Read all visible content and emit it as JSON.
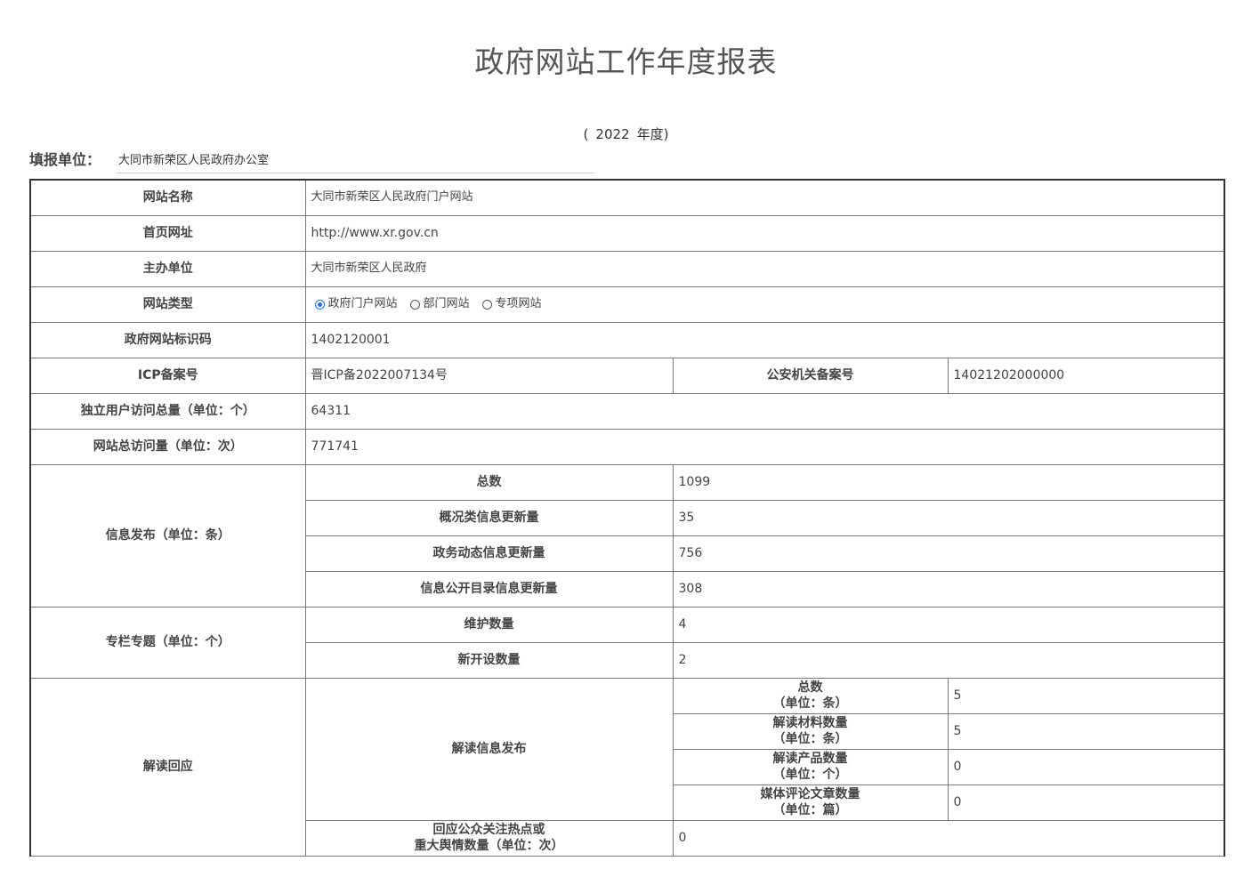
{
  "title": "政府网站工作年度报表",
  "year": {
    "open": "(",
    "value": "2022",
    "suffix": "年度)"
  },
  "unit": {
    "label": "填报单位：",
    "value": "大同市新荣区人民政府办公室"
  },
  "rows": {
    "site_name": {
      "label": "网站名称",
      "value": "大同市新荣区人民政府门户网站"
    },
    "home_url": {
      "label": "首页网址",
      "value": "http://www.xr.gov.cn"
    },
    "host": {
      "label": "主办单位",
      "value": "大同市新荣区人民政府"
    },
    "site_type": {
      "label": "网站类型",
      "options": [
        {
          "label": "政府门户网站",
          "checked": true
        },
        {
          "label": "部门网站",
          "checked": false
        },
        {
          "label": "专项网站",
          "checked": false
        }
      ]
    },
    "site_id": {
      "label": "政府网站标识码",
      "value": "1402120001"
    },
    "icp": {
      "label": "ICP备案号",
      "value": "晋ICP备2022007134号",
      "police_label": "公安机关备案号",
      "police_value": "14021202000000"
    },
    "uv": {
      "label": "独立用户访问总量（单位：个）",
      "value": "64311"
    },
    "pv": {
      "label": "网站总访问量（单位：次）",
      "value": "771741"
    },
    "info": {
      "label": "信息发布（单位：条）",
      "items": [
        {
          "label": "总数",
          "value": "1099"
        },
        {
          "label": "概况类信息更新量",
          "value": "35"
        },
        {
          "label": "政务动态信息更新量",
          "value": "756"
        },
        {
          "label": "信息公开目录信息更新量",
          "value": "308"
        }
      ]
    },
    "column": {
      "label": "专栏专题（单位：个）",
      "items": [
        {
          "label": "维护数量",
          "value": "4"
        },
        {
          "label": "新开设数量",
          "value": "2"
        }
      ]
    },
    "interpret": {
      "label": "解读回应",
      "sub_label": "解读信息发布",
      "items": [
        {
          "line1": "总数",
          "line2": "（单位：条）",
          "value": "5"
        },
        {
          "line1": "解读材料数量",
          "line2": "（单位：条）",
          "value": "5"
        },
        {
          "line1": "解读产品数量",
          "line2": "（单位：个）",
          "value": "0"
        },
        {
          "line1": "媒体评论文章数量",
          "line2": "（单位：篇）",
          "value": "0"
        }
      ],
      "response": {
        "line1": "回应公众关注热点或",
        "line2": "重大舆情数量（单位：次）",
        "value": "0"
      }
    }
  }
}
